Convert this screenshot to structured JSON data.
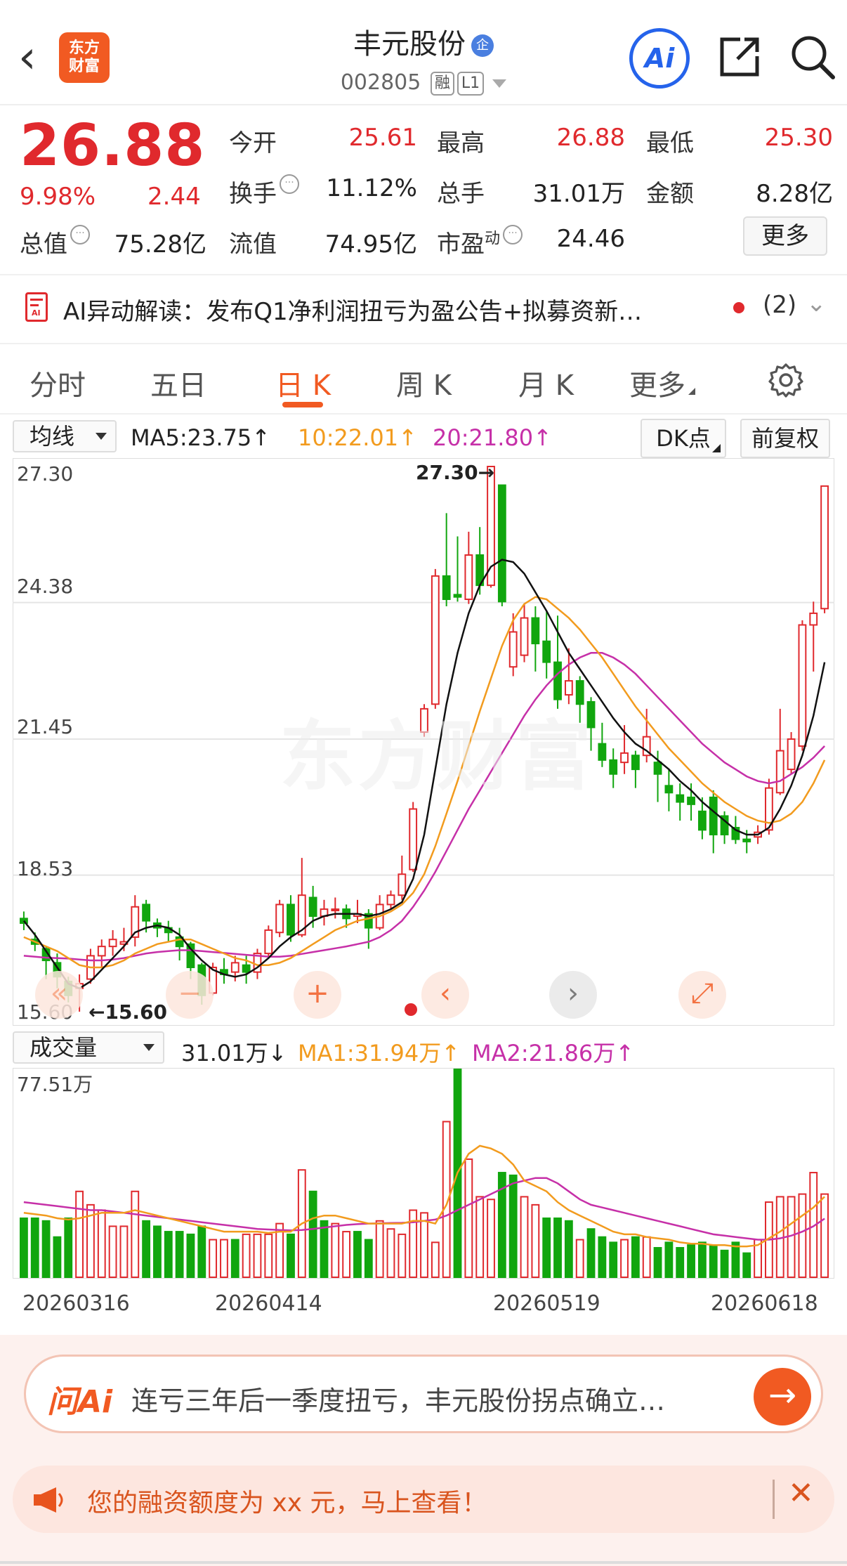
{
  "header": {
    "back_glyph": "‹",
    "logo_text": "东方财富",
    "stock_name": "丰元股份",
    "ent_badge": "企",
    "code": "002805",
    "tags": [
      "融",
      "L1"
    ],
    "ai_label": "Ai"
  },
  "quote": {
    "price": "26.88",
    "change_pct": "9.98%",
    "change_val": "2.44",
    "open_label": "今开",
    "open": "25.61",
    "high_label": "最高",
    "high": "26.88",
    "low_label": "最低",
    "low": "25.30",
    "turnover_label": "换手",
    "turnover": "11.12%",
    "volume_label": "总手",
    "volume": "31.01万",
    "amount_label": "金额",
    "amount": "8.28亿",
    "mcap_label": "总值",
    "mcap": "75.28亿",
    "float_label": "流值",
    "float": "74.95亿",
    "pe_label": "市盈",
    "pe_sup": "动",
    "pe": "24.46",
    "more_label": "更多"
  },
  "ai_strip": {
    "text": "AI异动解读：发布Q1净利润扭亏为盈公告+拟募资新…",
    "count": "(2)",
    "chevron": "⌄"
  },
  "tabs": [
    {
      "label": "分时"
    },
    {
      "label": "五日"
    },
    {
      "label": "日 K"
    },
    {
      "label": "周 K"
    },
    {
      "label": "月 K"
    },
    {
      "label": "更多"
    }
  ],
  "indicators": {
    "ma_select": "均线",
    "ma5": "MA5:23.75↑",
    "ma10": "10:22.01↑",
    "ma20": "20:21.80↑",
    "dk_label": "DK点",
    "fq_label": "前复权",
    "vol_select": "成交量",
    "vol_now": "31.01万↓",
    "vol_ma1": "MA1:31.94万↑",
    "vol_ma2": "MA2:21.86万↑"
  },
  "kchart": {
    "y_labels": [
      "27.30",
      "24.38",
      "21.45",
      "18.53",
      "15.60"
    ],
    "max_note": "27.30→",
    "min_note": "←15.60",
    "watermark": "东方财富",
    "vol_max_label": "77.51万",
    "dates": [
      "20260316",
      "20260414",
      "20260519",
      "20260618"
    ]
  },
  "chart_data": {
    "type": "candlestick",
    "ylim": [
      15.6,
      27.3
    ],
    "candles": [
      [
        17.6,
        17.5,
        17.75,
        17.35
      ],
      [
        17.15,
        17.05,
        17.3,
        16.9
      ],
      [
        16.95,
        16.7,
        17.0,
        16.3
      ],
      [
        16.65,
        16.35,
        16.85,
        16.1
      ],
      [
        16.25,
        15.95,
        16.35,
        15.8
      ],
      [
        16.1,
        16.2,
        16.4,
        15.6
      ],
      [
        16.3,
        16.8,
        16.95,
        16.2
      ],
      [
        16.8,
        17.0,
        17.15,
        16.55
      ],
      [
        17.0,
        17.15,
        17.35,
        16.8
      ],
      [
        17.05,
        17.1,
        17.4,
        16.9
      ],
      [
        17.2,
        17.85,
        18.1,
        17.0
      ],
      [
        17.9,
        17.55,
        18.0,
        17.3
      ],
      [
        17.5,
        17.4,
        17.6,
        17.2
      ],
      [
        17.4,
        17.3,
        17.55,
        17.1
      ],
      [
        17.2,
        17.0,
        17.4,
        16.7
      ],
      [
        17.05,
        16.55,
        17.1,
        16.3
      ],
      [
        16.6,
        15.95,
        16.65,
        15.75
      ],
      [
        16.0,
        16.55,
        16.65,
        15.95
      ],
      [
        16.5,
        16.4,
        16.75,
        16.2
      ],
      [
        16.45,
        16.65,
        16.8,
        16.25
      ],
      [
        16.6,
        16.45,
        16.8,
        16.2
      ],
      [
        16.45,
        16.85,
        16.95,
        16.3
      ],
      [
        16.85,
        17.35,
        17.45,
        16.75
      ],
      [
        17.3,
        17.9,
        18.0,
        17.2
      ],
      [
        17.9,
        17.25,
        18.1,
        17.1
      ],
      [
        17.25,
        18.1,
        18.9,
        17.2
      ],
      [
        18.05,
        17.65,
        18.3,
        17.4
      ],
      [
        17.65,
        17.8,
        18.0,
        17.45
      ],
      [
        17.8,
        17.8,
        18.05,
        17.6
      ],
      [
        17.8,
        17.6,
        17.9,
        17.4
      ],
      [
        17.65,
        17.7,
        18.0,
        17.5
      ],
      [
        17.7,
        17.4,
        17.8,
        16.95
      ],
      [
        17.4,
        17.9,
        18.1,
        17.35
      ],
      [
        17.9,
        18.1,
        18.2,
        17.8
      ],
      [
        18.1,
        18.55,
        18.95,
        18.0
      ],
      [
        18.65,
        19.95,
        20.1,
        18.6
      ],
      [
        21.6,
        22.1,
        22.2,
        21.5
      ],
      [
        22.2,
        24.95,
        25.1,
        22.1
      ],
      [
        24.95,
        24.45,
        26.3,
        24.3
      ],
      [
        24.55,
        24.5,
        25.8,
        24.4
      ],
      [
        24.45,
        25.4,
        25.9,
        24.35
      ],
      [
        25.4,
        24.75,
        26.0,
        24.55
      ],
      [
        24.75,
        27.3,
        27.3,
        24.7
      ],
      [
        26.9,
        24.4,
        26.9,
        24.3
      ],
      [
        23.0,
        23.75,
        24.15,
        22.8
      ],
      [
        23.25,
        24.05,
        24.35,
        23.1
      ],
      [
        24.05,
        23.5,
        24.3,
        22.9
      ],
      [
        23.55,
        23.1,
        24.2,
        22.75
      ],
      [
        23.1,
        22.3,
        24.1,
        22.1
      ],
      [
        22.4,
        22.7,
        23.4,
        22.2
      ],
      [
        22.7,
        22.2,
        22.8,
        21.8
      ],
      [
        22.25,
        21.7,
        22.35,
        21.2
      ],
      [
        21.35,
        21.0,
        21.8,
        20.85
      ],
      [
        21.0,
        20.7,
        21.25,
        20.4
      ],
      [
        20.95,
        21.15,
        21.75,
        20.7
      ],
      [
        21.1,
        20.8,
        21.2,
        20.4
      ],
      [
        21.1,
        21.5,
        22.1,
        20.95
      ],
      [
        20.95,
        20.7,
        21.2,
        20.1
      ],
      [
        20.45,
        20.3,
        20.8,
        19.9
      ],
      [
        20.25,
        20.1,
        20.5,
        19.7
      ],
      [
        20.2,
        20.05,
        20.5,
        19.7
      ],
      [
        19.9,
        19.5,
        20.2,
        19.3
      ],
      [
        20.2,
        19.4,
        20.35,
        19.0
      ],
      [
        19.8,
        19.4,
        19.9,
        19.2
      ],
      [
        19.55,
        19.3,
        19.8,
        19.2
      ],
      [
        19.3,
        19.25,
        19.5,
        19.0
      ],
      [
        19.35,
        19.45,
        19.6,
        19.2
      ],
      [
        19.5,
        20.4,
        20.6,
        19.4
      ],
      [
        20.3,
        21.2,
        22.1,
        20.25
      ],
      [
        20.8,
        21.45,
        21.6,
        20.7
      ],
      [
        21.3,
        23.9,
        24.0,
        21.2
      ],
      [
        23.9,
        24.15,
        24.4,
        22.9
      ],
      [
        24.25,
        26.88,
        26.88,
        24.15
      ]
    ],
    "ma5": [
      17.55,
      17.25,
      16.9,
      16.55,
      16.2,
      16.1,
      16.25,
      16.5,
      16.75,
      17.0,
      17.3,
      17.4,
      17.45,
      17.4,
      17.25,
      16.95,
      16.7,
      16.5,
      16.4,
      16.35,
      16.4,
      16.55,
      16.75,
      17.0,
      17.2,
      17.35,
      17.55,
      17.65,
      17.7,
      17.7,
      17.7,
      17.65,
      17.7,
      17.8,
      17.95,
      18.45,
      19.4,
      20.8,
      22.2,
      23.3,
      24.15,
      24.75,
      25.15,
      25.3,
      25.25,
      25.0,
      24.6,
      24.2,
      23.75,
      23.3,
      22.95,
      22.6,
      22.25,
      21.9,
      21.6,
      21.35,
      21.2,
      21.0,
      20.8,
      20.55,
      20.35,
      20.1,
      19.9,
      19.7,
      19.5,
      19.4,
      19.4,
      19.55,
      19.95,
      20.45,
      21.1,
      21.95,
      23.1
    ],
    "ma10": [
      17.2,
      17.1,
      17.0,
      16.9,
      16.75,
      16.6,
      16.55,
      16.55,
      16.6,
      16.7,
      16.85,
      16.95,
      17.05,
      17.1,
      17.15,
      17.15,
      17.05,
      16.95,
      16.85,
      16.75,
      16.7,
      16.6,
      16.6,
      16.65,
      16.75,
      16.9,
      17.05,
      17.2,
      17.35,
      17.45,
      17.55,
      17.6,
      17.65,
      17.75,
      17.9,
      18.15,
      18.55,
      19.15,
      19.85,
      20.55,
      21.3,
      22.05,
      22.75,
      23.45,
      24.0,
      24.35,
      24.5,
      24.45,
      24.25,
      24.05,
      23.8,
      23.5,
      23.2,
      22.85,
      22.5,
      22.15,
      21.85,
      21.55,
      21.25,
      21.0,
      20.75,
      20.5,
      20.3,
      20.1,
      19.95,
      19.8,
      19.7,
      19.65,
      19.7,
      19.85,
      20.1,
      20.5,
      21.0
    ],
    "ma20": [
      16.8,
      16.78,
      16.76,
      16.75,
      16.74,
      16.72,
      16.7,
      16.7,
      16.72,
      16.75,
      16.8,
      16.85,
      16.88,
      16.9,
      16.92,
      16.92,
      16.9,
      16.88,
      16.86,
      16.84,
      16.82,
      16.8,
      16.78,
      16.78,
      16.8,
      16.84,
      16.88,
      16.92,
      16.96,
      17.0,
      17.05,
      17.1,
      17.2,
      17.35,
      17.55,
      17.85,
      18.2,
      18.6,
      19.05,
      19.5,
      19.95,
      20.35,
      20.75,
      21.15,
      21.55,
      21.95,
      22.3,
      22.6,
      22.85,
      23.05,
      23.2,
      23.3,
      23.3,
      23.2,
      23.05,
      22.85,
      22.6,
      22.35,
      22.1,
      21.85,
      21.6,
      21.35,
      21.15,
      20.95,
      20.8,
      20.65,
      20.55,
      20.5,
      20.55,
      20.7,
      20.85,
      21.05,
      21.3
    ],
    "volume": [
      {
        "v": 22.0,
        "up": false
      },
      {
        "v": 22.0,
        "up": false
      },
      {
        "v": 21.0,
        "up": false
      },
      {
        "v": 15.0,
        "up": false
      },
      {
        "v": 22.0,
        "up": false
      },
      {
        "v": 32.0,
        "up": true
      },
      {
        "v": 27.0,
        "up": true
      },
      {
        "v": 25.0,
        "up": true
      },
      {
        "v": 19.0,
        "up": true
      },
      {
        "v": 19.0,
        "up": true
      },
      {
        "v": 32.0,
        "up": true
      },
      {
        "v": 21.0,
        "up": false
      },
      {
        "v": 19.0,
        "up": false
      },
      {
        "v": 17.0,
        "up": false
      },
      {
        "v": 17.0,
        "up": false
      },
      {
        "v": 16.0,
        "up": false
      },
      {
        "v": 19.0,
        "up": false
      },
      {
        "v": 14.0,
        "up": true
      },
      {
        "v": 14.0,
        "up": true
      },
      {
        "v": 14.0,
        "up": false
      },
      {
        "v": 16.0,
        "up": true
      },
      {
        "v": 16.0,
        "up": true
      },
      {
        "v": 16.0,
        "up": true
      },
      {
        "v": 20.0,
        "up": true
      },
      {
        "v": 16.0,
        "up": false
      },
      {
        "v": 40.0,
        "up": true
      },
      {
        "v": 32.0,
        "up": false
      },
      {
        "v": 21.0,
        "up": false
      },
      {
        "v": 20.0,
        "up": true
      },
      {
        "v": 17.0,
        "up": true
      },
      {
        "v": 17.0,
        "up": false
      },
      {
        "v": 14.0,
        "up": false
      },
      {
        "v": 21.0,
        "up": true
      },
      {
        "v": 18.0,
        "up": true
      },
      {
        "v": 16.0,
        "up": true
      },
      {
        "v": 25.0,
        "up": true
      },
      {
        "v": 24.0,
        "up": true
      },
      {
        "v": 13.0,
        "up": true
      },
      {
        "v": 58.0,
        "up": true
      },
      {
        "v": 77.5,
        "up": false
      },
      {
        "v": 44.0,
        "up": true
      },
      {
        "v": 30.0,
        "up": true
      },
      {
        "v": 29.0,
        "up": true
      },
      {
        "v": 39.0,
        "up": false
      },
      {
        "v": 38.0,
        "up": false
      },
      {
        "v": 30.0,
        "up": true
      },
      {
        "v": 27.0,
        "up": true
      },
      {
        "v": 22.0,
        "up": false
      },
      {
        "v": 22.0,
        "up": false
      },
      {
        "v": 21.0,
        "up": false
      },
      {
        "v": 14.0,
        "up": true
      },
      {
        "v": 18.0,
        "up": false
      },
      {
        "v": 15.0,
        "up": false
      },
      {
        "v": 13.0,
        "up": false
      },
      {
        "v": 14.0,
        "up": true
      },
      {
        "v": 15.0,
        "up": false
      },
      {
        "v": 15.0,
        "up": true
      },
      {
        "v": 11.0,
        "up": false
      },
      {
        "v": 13.0,
        "up": false
      },
      {
        "v": 11.0,
        "up": false
      },
      {
        "v": 12.0,
        "up": false
      },
      {
        "v": 13.0,
        "up": false
      },
      {
        "v": 12.0,
        "up": false
      },
      {
        "v": 10.0,
        "up": false
      },
      {
        "v": 13.0,
        "up": false
      },
      {
        "v": 9.0,
        "up": false
      },
      {
        "v": 14.0,
        "up": true
      },
      {
        "v": 28.0,
        "up": true
      },
      {
        "v": 30.0,
        "up": true
      },
      {
        "v": 30.0,
        "up": true
      },
      {
        "v": 31.0,
        "up": true
      },
      {
        "v": 39.0,
        "up": true
      },
      {
        "v": 31.0,
        "up": true
      }
    ],
    "vol_ma1": [
      24,
      23.5,
      23,
      22,
      21.5,
      22,
      23,
      24,
      24,
      24,
      25,
      24,
      23,
      22,
      21,
      20,
      19,
      18,
      17,
      17,
      17,
      17,
      16.5,
      17,
      17,
      20,
      22,
      23,
      23,
      22,
      21,
      20,
      20,
      20,
      20,
      21,
      21,
      20,
      27,
      39,
      46,
      49,
      48,
      46,
      42,
      36,
      34,
      32,
      28,
      25,
      23,
      21,
      19,
      17,
      16,
      16,
      15,
      14.5,
      14,
      13,
      12.5,
      12.5,
      12,
      12,
      11.5,
      11.5,
      12,
      14.5,
      17,
      20,
      23,
      26,
      30
    ],
    "vol_ma2": [
      28,
      27.5,
      27,
      26.5,
      26,
      25.5,
      25,
      25,
      24.5,
      24,
      23.5,
      23,
      22.5,
      22,
      21.5,
      21,
      20.5,
      20,
      19.5,
      19,
      18.5,
      18,
      17.8,
      17.6,
      17.5,
      17.6,
      18,
      18.5,
      19,
      19.5,
      19.8,
      20,
      20.1,
      20.2,
      20.3,
      20.5,
      21,
      21.5,
      23,
      25,
      27,
      29,
      31,
      33,
      35,
      36,
      37,
      37,
      35,
      32,
      29,
      27,
      26,
      25,
      24,
      23,
      22,
      21,
      20,
      19,
      18,
      17,
      16,
      15.5,
      15,
      14.5,
      14,
      14,
      14.5,
      15.5,
      17,
      19,
      21.86
    ]
  },
  "controls": {
    "rewind": "«",
    "minus": "−",
    "plus": "+",
    "prev": "‹",
    "next": "›",
    "expand": "⤢"
  },
  "bottom": {
    "ask_logo": "问Ai",
    "ask_text": "连亏三年后一季度扭亏，丰元股份拐点确立…",
    "go_arrow": "→",
    "margin_text": "您的融资额度为 xx 元，马上查看！",
    "close_glyph": "✕"
  }
}
